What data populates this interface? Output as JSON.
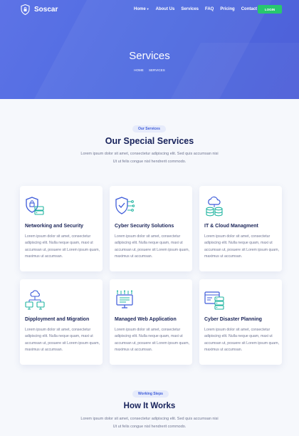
{
  "brand": {
    "name": "Soscar",
    "icon": "shield-lock-icon"
  },
  "nav": [
    {
      "label": "Home",
      "has_dropdown": true
    },
    {
      "label": "About Us"
    },
    {
      "label": "Services"
    },
    {
      "label": "FAQ"
    },
    {
      "label": "Pricing"
    },
    {
      "label": "Contact"
    }
  ],
  "login_label": "LOGIN",
  "hero": {
    "title": "Services",
    "breadcrumb": [
      "HOME",
      "SERVICES"
    ]
  },
  "services_section": {
    "pill": "Our Services",
    "title": "Our Special Services",
    "description": "Lorem ipsum dolor sit amet, consectetur adipiscing elit. Sed quis accumsan nisi Ut ut felis congue nisl hendrerit commodo."
  },
  "cards": [
    {
      "title": "Networking and Security",
      "icon": "network-security-icon",
      "description": "Lorem ipsum dolor sit amet, consectetur adipiscing elit. Nulla neque quam, maxi ut accumsan ut, posuere sit Lorem ipsum quam, maximus ut accumsan."
    },
    {
      "title": "Cyber Security Solutions",
      "icon": "cyber-shield-icon",
      "description": "Lorem ipsum dolor sit amet, consectetur adipiscing elit. Nulla neque quam, maxi ut accumsan ut, posuere sit Lorem ipsum quam, maximus ut accumsan."
    },
    {
      "title": "IT & Cloud Managment",
      "icon": "cloud-database-icon",
      "description": "Lorem ipsum dolor sit amet, consectetur adipiscing elit. Nulla neque quam, maxi ut accumsan ut, posuere sit Lorem ipsum quam, maximus ut accumsan."
    },
    {
      "title": "Dipployment and Migration",
      "icon": "deployment-icon",
      "description": "Lorem ipsum dolor sit amet, consectetur adipiscing elit. Nulla neque quam, maxi ut accumsan ut, posuere sit Lorem ipsum quam, maximus ut accumsan."
    },
    {
      "title": "Managed Web Application",
      "icon": "web-app-icon",
      "description": "Lorem ipsum dolor sit amet, consectetur adipiscing elit. Nulla neque quam, maxi ut accumsan ut, posuere sit Lorem ipsum quam, maximus ut accumsan."
    },
    {
      "title": "Cyber Disaster Planning",
      "icon": "disaster-planning-icon",
      "description": "Lorem ipsum dolor sit amet, consectetur adipiscing elit. Nulla neque quam, maxi ut accumsan ut, posuere sit Lorem ipsum quam, maximus ut accumsan."
    }
  ],
  "steps_section": {
    "pill": "Working Steps",
    "title": "How It Works",
    "description": "Lorem ipsum dolor sit amet, consectetur adipiscing elit. Sed quis accumsan nisi Ut ut felis congue nisl hendrerit commodo."
  },
  "colors": {
    "hero": "#4d6ae0",
    "accent_green": "#28c76f",
    "icon_blue": "#3d5bd9",
    "icon_teal": "#1fb4a0",
    "heading": "#16215a"
  }
}
